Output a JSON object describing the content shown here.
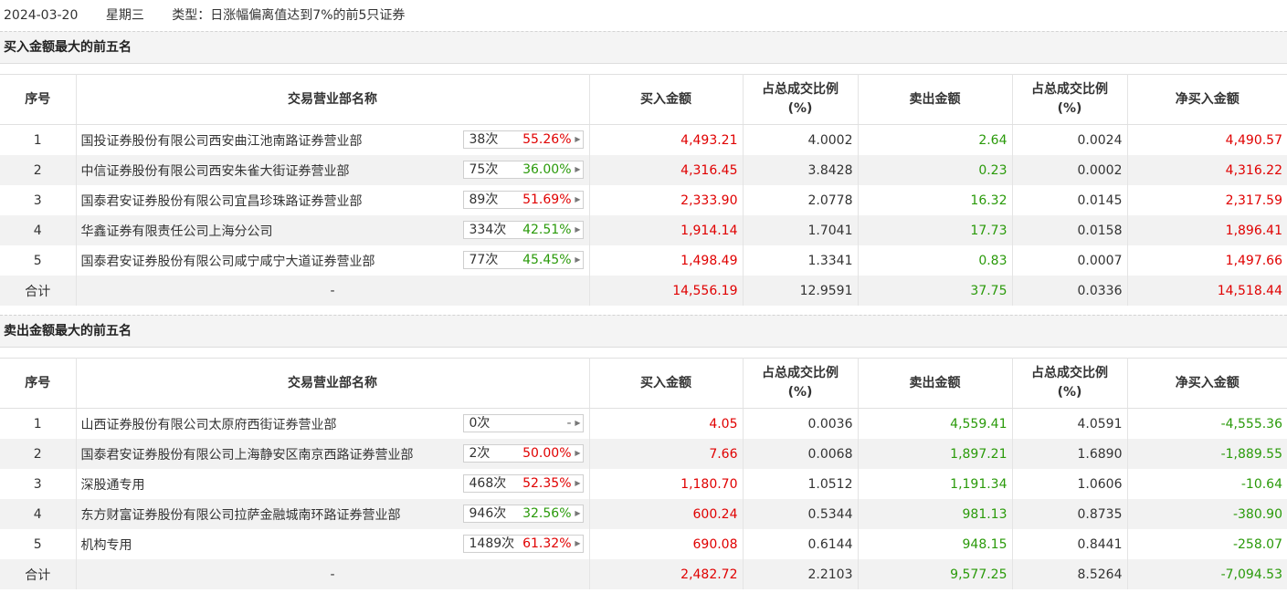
{
  "info": {
    "date": "2024-03-20",
    "weekday": "星期三",
    "type": "类型：日涨幅偏离值达到7%的前5只证券"
  },
  "columns": [
    "序号",
    "交易营业部名称",
    "买入金额",
    "占总成交比例\n(%)",
    "卖出金额",
    "占总成交比例\n(%)",
    "净买入金额"
  ],
  "sections": [
    {
      "title": "买入金额最大的前五名",
      "rows": [
        {
          "no": "1",
          "name": "国投证券股份有限公司西安曲江池南路证券营业部",
          "times": "38次",
          "pct": "55.26%",
          "pct_color": "red",
          "buy": "4,493.21",
          "buy_ratio": "4.0002",
          "sell": "2.64",
          "sell_ratio": "0.0024",
          "net": "4,490.57",
          "net_color": "red"
        },
        {
          "no": "2",
          "name": "中信证券股份有限公司西安朱雀大街证券营业部",
          "times": "75次",
          "pct": "36.00%",
          "pct_color": "green",
          "buy": "4,316.45",
          "buy_ratio": "3.8428",
          "sell": "0.23",
          "sell_ratio": "0.0002",
          "net": "4,316.22",
          "net_color": "red"
        },
        {
          "no": "3",
          "name": "国泰君安证券股份有限公司宜昌珍珠路证券营业部",
          "times": "89次",
          "pct": "51.69%",
          "pct_color": "red",
          "buy": "2,333.90",
          "buy_ratio": "2.0778",
          "sell": "16.32",
          "sell_ratio": "0.0145",
          "net": "2,317.59",
          "net_color": "red"
        },
        {
          "no": "4",
          "name": "华鑫证券有限责任公司上海分公司",
          "times": "334次",
          "pct": "42.51%",
          "pct_color": "green",
          "buy": "1,914.14",
          "buy_ratio": "1.7041",
          "sell": "17.73",
          "sell_ratio": "0.0158",
          "net": "1,896.41",
          "net_color": "red"
        },
        {
          "no": "5",
          "name": "国泰君安证券股份有限公司咸宁咸宁大道证券营业部",
          "times": "77次",
          "pct": "45.45%",
          "pct_color": "green",
          "buy": "1,498.49",
          "buy_ratio": "1.3341",
          "sell": "0.83",
          "sell_ratio": "0.0007",
          "net": "1,497.66",
          "net_color": "red"
        }
      ],
      "total": {
        "label": "合计",
        "name": "-",
        "buy": "14,556.19",
        "buy_ratio": "12.9591",
        "sell": "37.75",
        "sell_ratio": "0.0336",
        "net": "14,518.44",
        "net_color": "red"
      }
    },
    {
      "title": "卖出金额最大的前五名",
      "rows": [
        {
          "no": "1",
          "name": "山西证券股份有限公司太原府西街证券营业部",
          "times": "0次",
          "pct": "-",
          "pct_color": "gray",
          "buy": "4.05",
          "buy_ratio": "0.0036",
          "sell": "4,559.41",
          "sell_ratio": "4.0591",
          "net": "-4,555.36",
          "net_color": "green"
        },
        {
          "no": "2",
          "name": "国泰君安证券股份有限公司上海静安区南京西路证券营业部",
          "times": "2次",
          "pct": "50.00%",
          "pct_color": "red",
          "buy": "7.66",
          "buy_ratio": "0.0068",
          "sell": "1,897.21",
          "sell_ratio": "1.6890",
          "net": "-1,889.55",
          "net_color": "green"
        },
        {
          "no": "3",
          "name": "深股通专用",
          "times": "468次",
          "pct": "52.35%",
          "pct_color": "red",
          "buy": "1,180.70",
          "buy_ratio": "1.0512",
          "sell": "1,191.34",
          "sell_ratio": "1.0606",
          "net": "-10.64",
          "net_color": "green"
        },
        {
          "no": "4",
          "name": "东方财富证券股份有限公司拉萨金融城南环路证券营业部",
          "times": "946次",
          "pct": "32.56%",
          "pct_color": "green",
          "buy": "600.24",
          "buy_ratio": "0.5344",
          "sell": "981.13",
          "sell_ratio": "0.8735",
          "net": "-380.90",
          "net_color": "green"
        },
        {
          "no": "5",
          "name": "机构专用",
          "times": "1489次",
          "pct": "61.32%",
          "pct_color": "red",
          "buy": "690.08",
          "buy_ratio": "0.6144",
          "sell": "948.15",
          "sell_ratio": "0.8441",
          "net": "-258.07",
          "net_color": "green"
        }
      ],
      "total": {
        "label": "合计",
        "name": "-",
        "buy": "2,482.72",
        "buy_ratio": "2.2103",
        "sell": "9,577.25",
        "sell_ratio": "8.5264",
        "net": "-7,094.53",
        "net_color": "green"
      }
    }
  ]
}
